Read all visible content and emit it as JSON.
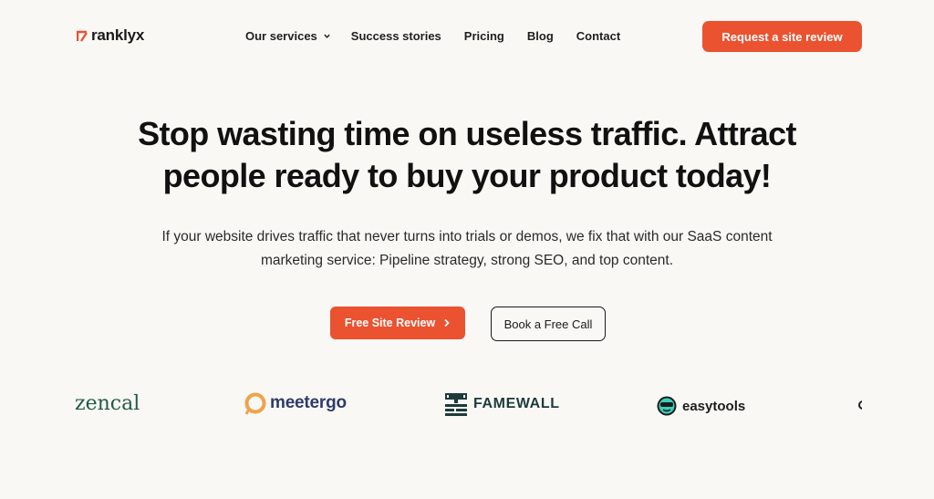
{
  "brand": {
    "name": "ranklyx",
    "accent": "#ea5230"
  },
  "nav": {
    "items": [
      "Our services",
      "Success stories",
      "Pricing",
      "Blog",
      "Contact"
    ],
    "header_cta": "Request a site review"
  },
  "hero": {
    "title": "Stop wasting time on useless traffic. Attract people ready to buy your product today!",
    "subtitle": "If your website drives traffic that never turns into trials or demos, we fix that with our SaaS content marketing service: Pipeline strategy, strong SEO, and top content.",
    "primary_cta": "Free Site Review",
    "secondary_cta": "Book a Free Call"
  },
  "clients": {
    "zencal": "zencal",
    "meetergo": "meetergo",
    "famewall": "FAMEWALL",
    "easytools": "easytools"
  },
  "icons": {
    "logo": "ranklyx-logo-mark-icon",
    "nav_dropdown": "chevron-down-icon",
    "primary_cta": "chevron-right-icon"
  }
}
